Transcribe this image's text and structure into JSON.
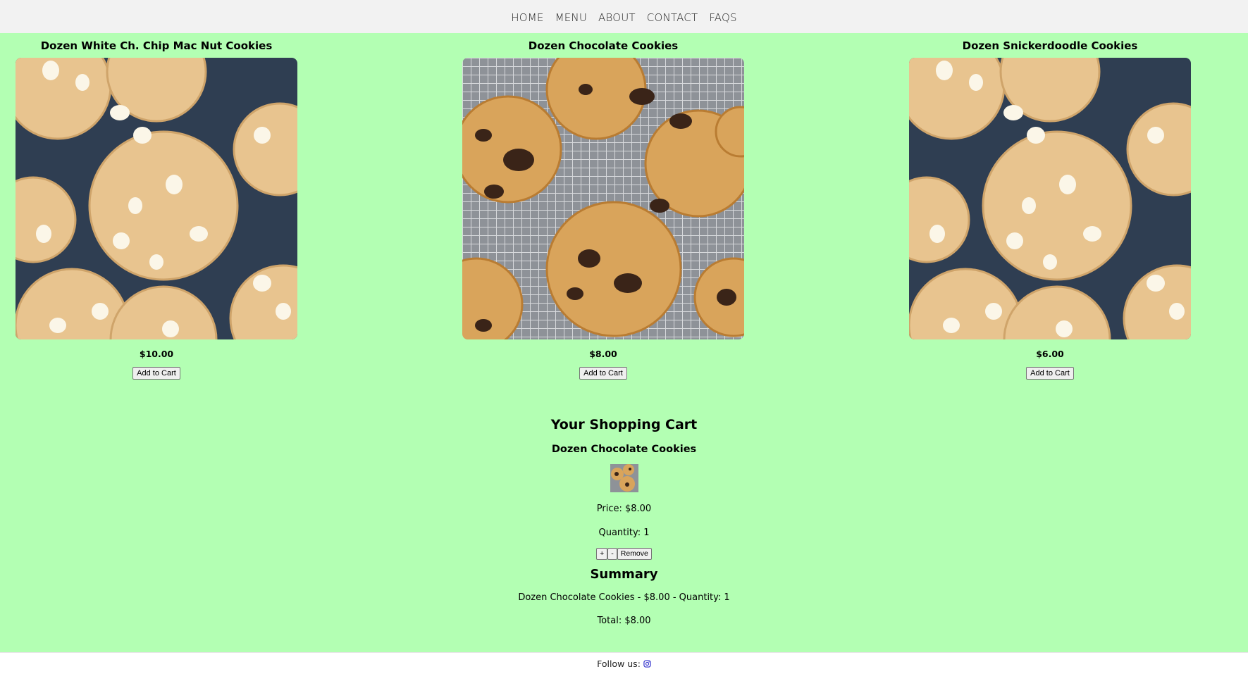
{
  "nav": {
    "items": [
      {
        "label": "HOME"
      },
      {
        "label": "MENU"
      },
      {
        "label": "ABOUT"
      },
      {
        "label": "CONTACT"
      },
      {
        "label": "FAQS"
      }
    ]
  },
  "products": [
    {
      "title": "Dozen White Ch. Chip Mac Nut Cookies",
      "price": "$10.00",
      "button": "Add to Cart",
      "image": "white-chocolate-macadamia-cookies"
    },
    {
      "title": "Dozen Chocolate Cookies",
      "price": "$8.00",
      "button": "Add to Cart",
      "image": "chocolate-chip-cookies-on-rack"
    },
    {
      "title": "Dozen Snickerdoodle Cookies",
      "price": "$6.00",
      "button": "Add to Cart",
      "image": "white-chocolate-macadamia-cookies"
    }
  ],
  "cart": {
    "heading": "Your Shopping Cart",
    "item": {
      "title": "Dozen Chocolate Cookies",
      "price_line": "Price: $8.00",
      "quantity_line": "Quantity: 1",
      "plus_label": "+",
      "minus_label": "-",
      "remove_label": "Remove"
    },
    "summary_heading": "Summary",
    "summary_line": "Dozen Chocolate Cookies - $8.00 - Quantity: 1",
    "total_line": "Total: $8.00"
  },
  "footer": {
    "follow_label": "Follow us:",
    "icon": "instagram-icon",
    "icon_color": "#3333cc"
  },
  "colors": {
    "page_background": "#b3ffb3",
    "nav_background": "#f2f2f2"
  }
}
